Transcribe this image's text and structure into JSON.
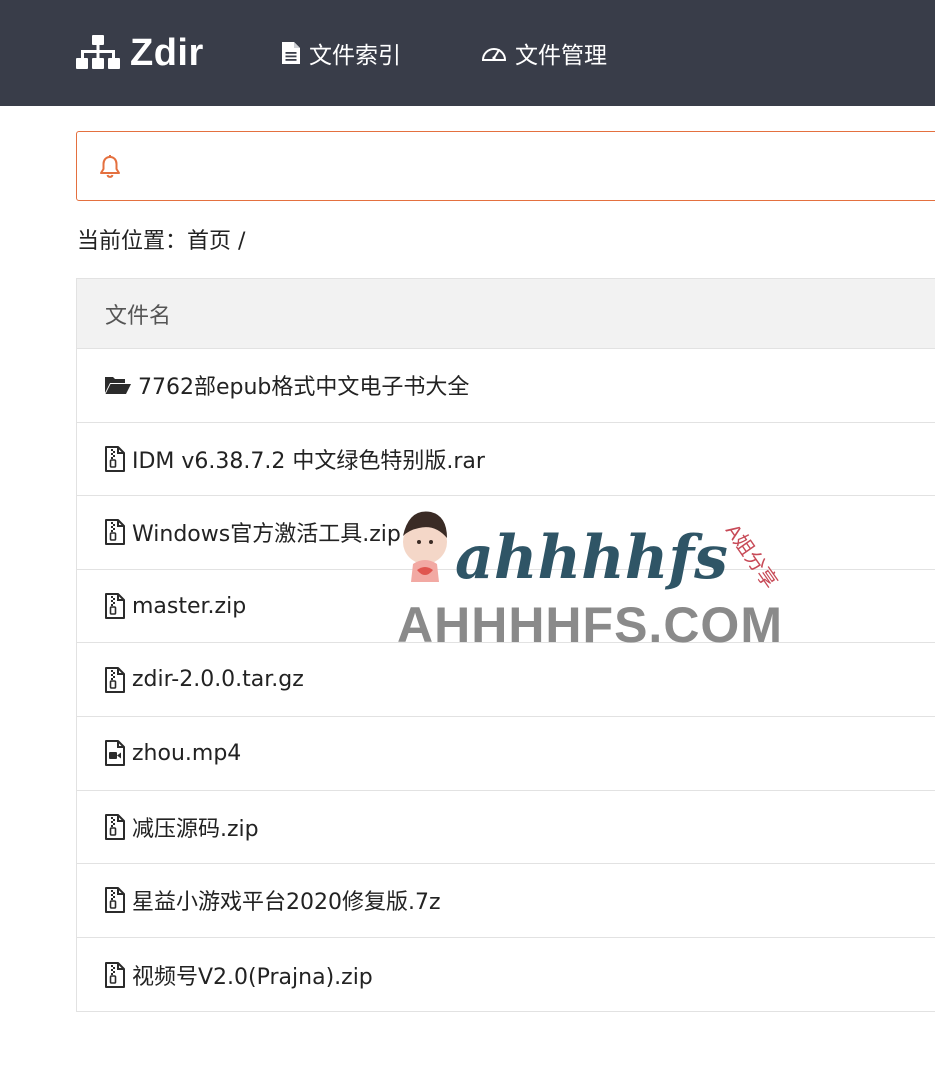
{
  "app": {
    "brand": "Zdir",
    "nav": [
      {
        "label": "文件索引",
        "icon": "file-text-icon"
      },
      {
        "label": "文件管理",
        "icon": "dashboard-icon"
      }
    ]
  },
  "notice": {
    "icon": "bell-icon",
    "text": "",
    "border_color": "#e4703f"
  },
  "breadcrumb": {
    "label": "当前位置：",
    "home": "首页",
    "separator": "/"
  },
  "table": {
    "header": "文件名",
    "rows": [
      {
        "name": "7762部epub格式中文电子书大全",
        "icon": "folder-open-icon"
      },
      {
        "name": "IDM v6.38.7.2 中文绿色特别版.rar",
        "icon": "file-zip-icon"
      },
      {
        "name": "Windows官方激活工具.zip",
        "icon": "file-zip-icon"
      },
      {
        "name": "master.zip",
        "icon": "file-zip-icon"
      },
      {
        "name": "zdir-2.0.0.tar.gz",
        "icon": "file-zip-icon"
      },
      {
        "name": "zhou.mp4",
        "icon": "file-video-icon"
      },
      {
        "name": "减压源码.zip",
        "icon": "file-zip-icon"
      },
      {
        "name": "星益小游戏平台2020修复版.7z",
        "icon": "file-zip-icon"
      },
      {
        "name": "视频号V2.0(Prajna).zip",
        "icon": "file-zip-icon"
      }
    ]
  },
  "watermark": {
    "script": "ahhhhfs",
    "site": "AHHHHFS.COM",
    "tag": "A姐分享"
  },
  "colors": {
    "topbar": "#393d49",
    "accent": "#e4703f"
  }
}
